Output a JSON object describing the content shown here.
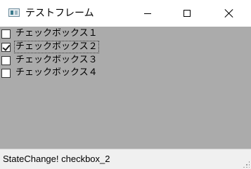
{
  "window": {
    "title": "テストフレーム",
    "icon": "app-window-icon"
  },
  "controls": {
    "minimize_icon": "minimize-icon",
    "maximize_icon": "maximize-icon",
    "close_icon": "close-icon"
  },
  "checkboxes": [
    {
      "label": "チェックボックス１",
      "checked": false,
      "focused": false
    },
    {
      "label": "チェックボックス２",
      "checked": true,
      "focused": true
    },
    {
      "label": "チェックボックス３",
      "checked": false,
      "focused": false
    },
    {
      "label": "チェックボックス４",
      "checked": false,
      "focused": false
    }
  ],
  "status": {
    "text": "StateChange! checkbox_2"
  },
  "colors": {
    "client_background": "#ababab",
    "statusbar_background": "#f0f0f0"
  }
}
